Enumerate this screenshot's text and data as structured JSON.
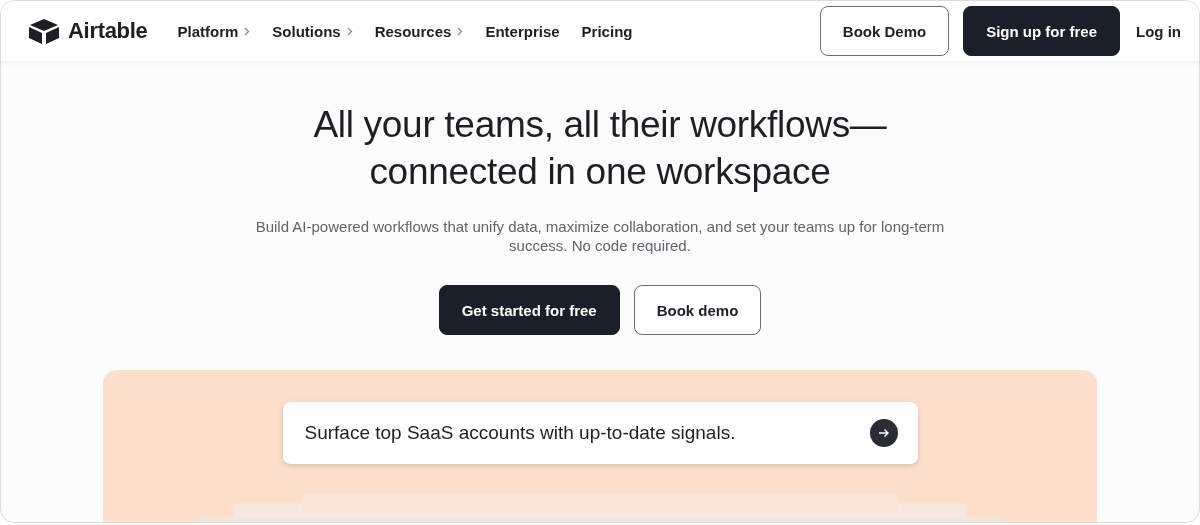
{
  "header": {
    "logo": "Airtable",
    "nav": [
      {
        "label": "Platform",
        "has_menu": true
      },
      {
        "label": "Solutions",
        "has_menu": true
      },
      {
        "label": "Resources",
        "has_menu": true
      },
      {
        "label": "Enterprise",
        "has_menu": false
      },
      {
        "label": "Pricing",
        "has_menu": false
      }
    ],
    "actions": [
      {
        "label": "Book Demo",
        "kind": "outline"
      },
      {
        "label": "Sign up for free",
        "kind": "filled"
      },
      {
        "label": "Log in",
        "kind": "link"
      }
    ]
  },
  "hero": {
    "title_lines": [
      "All your teams, all their workflows—",
      "connected in one workspace"
    ],
    "subtitle": "Build AI-powered workflows that unify data, maximize collaboration, and set your teams up for long-term success. No code required.",
    "buttons": [
      {
        "label": "Get started for free",
        "kind": "filled"
      },
      {
        "label": "Book demo",
        "kind": "outline"
      }
    ]
  },
  "showcase": {
    "prompt": "Surface top SaaS accounts with up-to-date signals."
  }
}
